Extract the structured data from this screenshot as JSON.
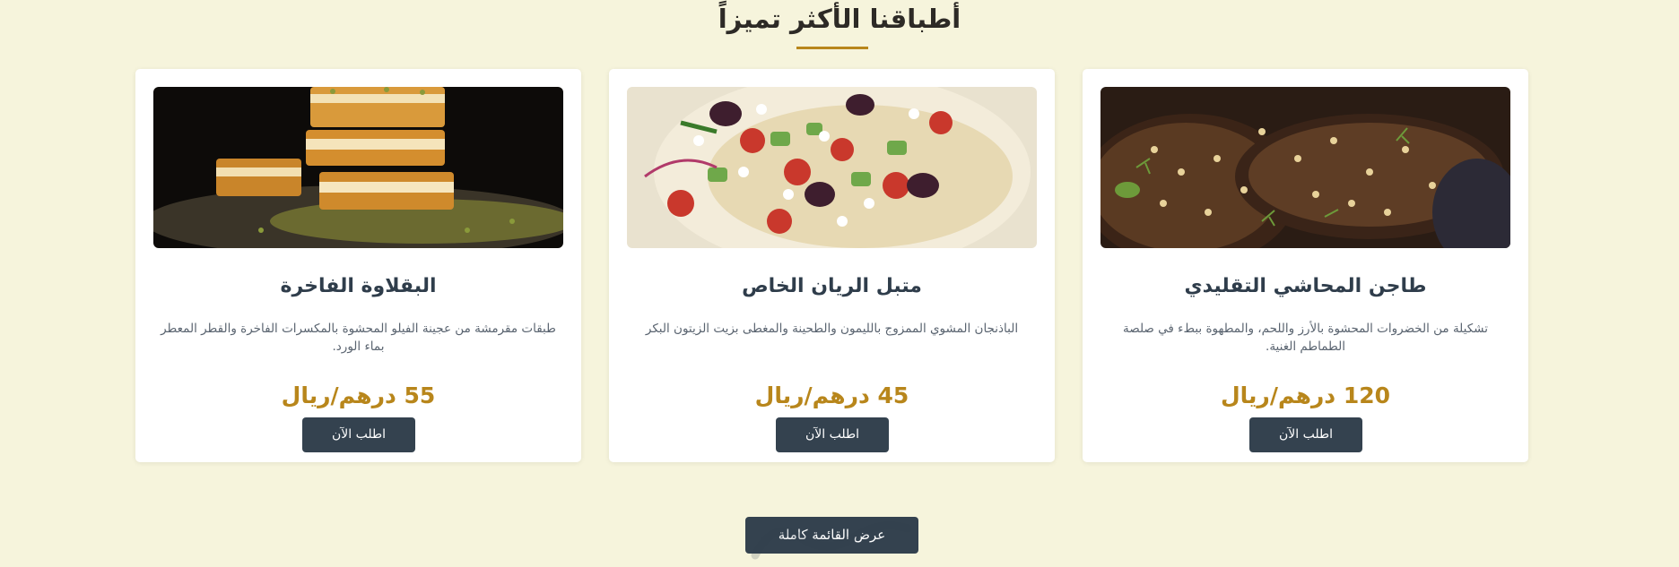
{
  "section": {
    "title": "أطباقنا الأكثر تميزاً"
  },
  "dishes": [
    {
      "title": "طاجن المحاشي التقليدي",
      "description": "تشكيلة من الخضروات المحشوة بالأرز واللحم، والمطهوة ببطء في صلصة الطماطم الغنية.",
      "price": "120 درهم/ريال",
      "button_label": "اطلب الآن",
      "image": "stuffed-eggplant-photo"
    },
    {
      "title": "متبل الريان الخاص",
      "description": "الباذنجان المشوي الممزوج بالليمون والطحينة والمغطى بزيت الزيتون البكر",
      "price": "45 درهم/ريال",
      "button_label": "اطلب الآن",
      "image": "moutabal-salad-photo"
    },
    {
      "title": "البقلاوة الفاخرة",
      "description": "طبقات مقرمشة من عجينة الفيلو المحشوة بالمكسرات الفاخرة والقطر المعطر بماء الورد.",
      "price": "55 درهم/ريال",
      "button_label": "اطلب الآن",
      "image": "baklava-photo"
    }
  ],
  "footer": {
    "view_menu_label": "عرض القائمة كاملة"
  },
  "colors": {
    "background": "#f6f4dc",
    "accent": "#b8861b",
    "button": "#34424f",
    "heading": "#2f3d4b"
  }
}
